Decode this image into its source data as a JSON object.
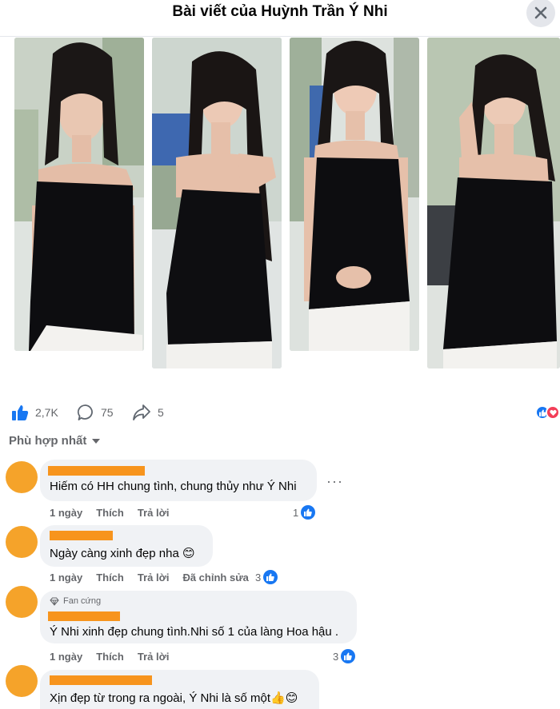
{
  "header": {
    "title": "Bài viết của Huỳnh Trần Ý Nhi"
  },
  "stats": {
    "likes": "2,7K",
    "comments": "75",
    "shares": "5"
  },
  "sort_label": "Phù hợp nhất",
  "colors": {
    "accent": "#1877f2",
    "avatar": "#f5a32a",
    "redaction": "#f7941d",
    "love": "#f33e58"
  },
  "comments": [
    {
      "text": "Hiếm có HH chung tình, chung thủy như Ý Nhi",
      "time": "1 ngày",
      "like": "Thích",
      "reply": "Trả lời",
      "reactions": "1"
    },
    {
      "text": "Ngày càng xinh đẹp nha 😊",
      "time": "1 ngày",
      "like": "Thích",
      "reply": "Trả lời",
      "edited": "Đã chỉnh sửa",
      "reactions": "3"
    },
    {
      "badge": "Fan cứng",
      "text": "Ý Nhi xinh đẹp chung tình.Nhi số 1 của làng Hoa hậu .",
      "time": "1 ngày",
      "like": "Thích",
      "reply": "Trả lời",
      "reactions": "3"
    },
    {
      "text": "Xịn đẹp từ trong ra ngoài, Ý Nhi là số một👍😊"
    }
  ]
}
